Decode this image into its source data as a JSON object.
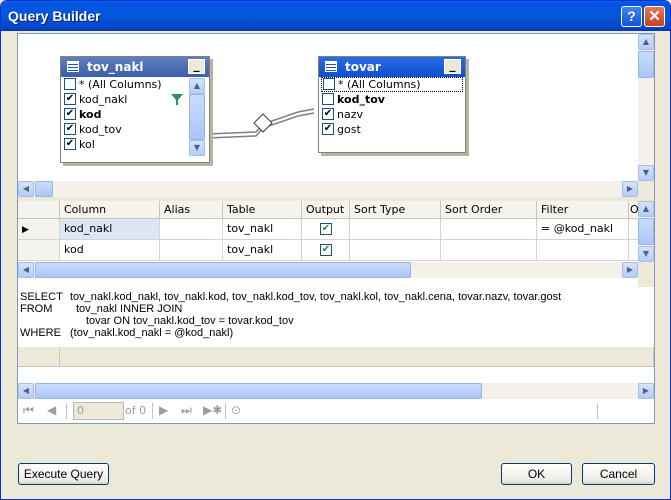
{
  "window": {
    "title": "Query Builder"
  },
  "tables": [
    {
      "name": "tov_nakl",
      "columns": [
        {
          "label": "* (All Columns)",
          "checked": false,
          "bold": false
        },
        {
          "label": "kod_nakl",
          "checked": true,
          "bold": false
        },
        {
          "label": "kod",
          "checked": true,
          "bold": true
        },
        {
          "label": "kod_tov",
          "checked": true,
          "bold": false
        },
        {
          "label": "kol",
          "checked": true,
          "bold": false
        }
      ]
    },
    {
      "name": "tovar",
      "columns": [
        {
          "label": "* (All Columns)",
          "checked": false,
          "bold": false
        },
        {
          "label": "kod_tov",
          "checked": false,
          "bold": true
        },
        {
          "label": "nazv",
          "checked": true,
          "bold": false
        },
        {
          "label": "gost",
          "checked": true,
          "bold": false
        }
      ]
    }
  ],
  "grid": {
    "headers": [
      "Column",
      "Alias",
      "Table",
      "Output",
      "Sort Type",
      "Sort Order",
      "Filter",
      "O"
    ],
    "rows": [
      {
        "column": "kod_nakl",
        "alias": "",
        "table": "tov_nakl",
        "output": true,
        "sort_type": "",
        "sort_order": "",
        "filter": "= @kod_nakl"
      },
      {
        "column": "kod",
        "alias": "",
        "table": "tov_nakl",
        "output": true,
        "sort_type": "",
        "sort_order": "",
        "filter": ""
      }
    ]
  },
  "sql": [
    {
      "kw": "SELECT",
      "text": "tov_nakl.kod_nakl, tov_nakl.kod, tov_nakl.kod_tov, tov_nakl.kol, tov_nakl.cena, tovar.nazv, tovar.gost"
    },
    {
      "kw": "FROM",
      "text": "tov_nakl INNER JOIN"
    },
    {
      "kw": "",
      "text": "tovar ON tov_nakl.kod_tov = tovar.kod_tov"
    },
    {
      "kw": "WHERE",
      "text": "(tov_nakl.kod_nakl = @kod_nakl)"
    }
  ],
  "nav": {
    "position": "0",
    "of_label": "of 0"
  },
  "buttons": {
    "execute": "Execute Query",
    "ok": "OK",
    "cancel": "Cancel"
  }
}
